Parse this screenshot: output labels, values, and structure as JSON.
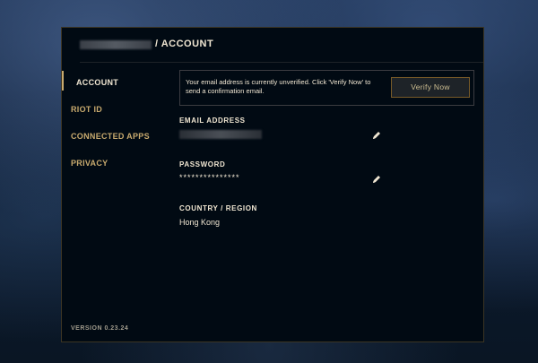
{
  "header": {
    "title": "/ ACCOUNT"
  },
  "nav": {
    "items": [
      {
        "label": "ACCOUNT"
      },
      {
        "label": "RIOT ID"
      },
      {
        "label": "CONNECTED APPS"
      },
      {
        "label": "PRIVACY"
      }
    ],
    "version": "VERSION 0.23.24"
  },
  "notice": {
    "message": "Your email address is currently unverified. Click 'Verify Now' to send a confirmation email.",
    "button_label": "Verify Now"
  },
  "fields": {
    "email_label": "EMAIL ADDRESS",
    "password_label": "PASSWORD",
    "password_value": "***************",
    "country_label": "COUNTRY / REGION",
    "country_value": "Hong Kong"
  },
  "icons": {
    "edit": "pencil-icon"
  },
  "colors": {
    "gold": "#c8aa6e",
    "text": "#f0e6d2",
    "panel_bg": "#010a13",
    "border": "#3c3523"
  }
}
